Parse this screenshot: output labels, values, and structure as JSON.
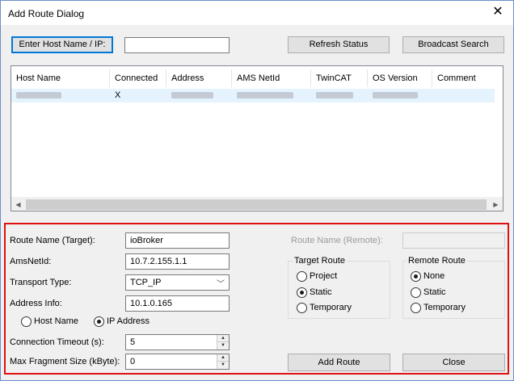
{
  "window": {
    "title": "Add Route Dialog",
    "close_glyph": "✕"
  },
  "toolbar": {
    "enter_host_label": "Enter Host Name / IP:",
    "host_input_value": "",
    "refresh_label": "Refresh Status",
    "broadcast_label": "Broadcast Search"
  },
  "hosts": {
    "columns": [
      "Host Name",
      "Connected",
      "Address",
      "AMS NetId",
      "TwinCAT",
      "OS Version",
      "Comment"
    ],
    "rows": [
      {
        "host_name": "",
        "connected": "X",
        "address": "",
        "ams_netid": "",
        "twincat": "",
        "os_version": "",
        "comment": ""
      }
    ]
  },
  "form": {
    "route_name_target_label": "Route Name (Target):",
    "route_name_target_value": "ioBroker",
    "amsnetid_label": "AmsNetId:",
    "amsnetid_value": "10.7.2.155.1.1",
    "transport_label": "Transport Type:",
    "transport_value": "TCP_IP",
    "address_info_label": "Address Info:",
    "address_info_value": "10.1.0.165",
    "host_name_radio": "Host Name",
    "ip_address_radio": "IP Address",
    "connection_timeout_label": "Connection Timeout (s):",
    "connection_timeout_value": "5",
    "max_fragment_label": "Max Fragment Size (kByte):",
    "max_fragment_value": "0",
    "route_name_remote_label": "Route Name (Remote):",
    "route_name_remote_value": ""
  },
  "target_route": {
    "title": "Target Route",
    "options": [
      "Project",
      "Static",
      "Temporary"
    ],
    "selected": "Static"
  },
  "remote_route": {
    "title": "Remote Route",
    "options": [
      "None",
      "Static",
      "Temporary"
    ],
    "selected": "None"
  },
  "buttons": {
    "add_route": "Add Route",
    "close": "Close"
  },
  "colors": {
    "highlight_border": "#e01010",
    "focus_blue": "#0078d7",
    "selected_row": "#e5f3ff"
  }
}
